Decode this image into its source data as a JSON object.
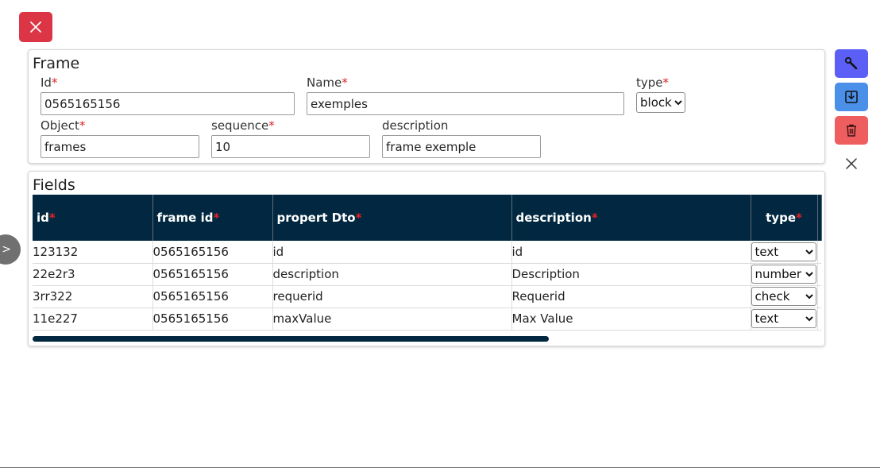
{
  "frame_panel": {
    "title": "Frame",
    "fields": {
      "id": {
        "label": "Id",
        "value": "0565165156"
      },
      "name": {
        "label": "Name",
        "value": "exemples"
      },
      "type": {
        "label": "type",
        "selected": "block"
      },
      "object": {
        "label": "Object",
        "value": "frames"
      },
      "sequence": {
        "label": "sequence",
        "value": "10"
      },
      "description": {
        "label": "description",
        "value": "frame exemple"
      }
    },
    "required_mark": "*"
  },
  "fields_panel": {
    "title": "Fields",
    "columns": [
      "id",
      "frame id",
      "propert Dto",
      "description",
      "type"
    ],
    "rows": [
      {
        "id": "123132",
        "frame_id": "0565165156",
        "propert_dto": "id",
        "description": "id",
        "type": "text"
      },
      {
        "id": "22e2r3",
        "frame_id": "0565165156",
        "propert_dto": "description",
        "description": "Description",
        "type": "number"
      },
      {
        "id": "3rr322",
        "frame_id": "0565165156",
        "propert_dto": "requerid",
        "description": "Requerid",
        "type": "check"
      },
      {
        "id": "11e227",
        "frame_id": "0565165156",
        "propert_dto": "maxValue",
        "description": "Max Value",
        "type": "text"
      }
    ]
  },
  "expand_button": {
    "label": ">"
  },
  "colors": {
    "danger": "#dc3545",
    "primary": "#5b5ff5",
    "info": "#4a90e8",
    "delete": "#ee5e5e",
    "table_header": "#012840"
  },
  "icons": {
    "close_top": "close-icon",
    "settings": "wrench-icon",
    "save": "download-box-icon",
    "delete": "trash-icon",
    "side_close": "close-icon"
  }
}
